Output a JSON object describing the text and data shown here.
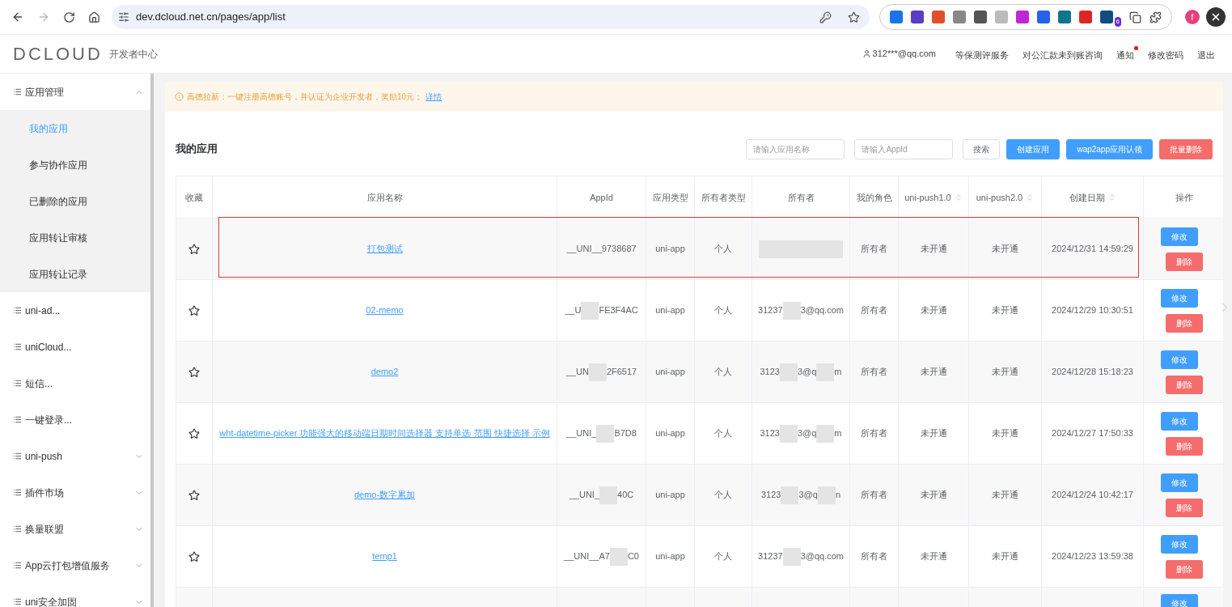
{
  "browser": {
    "url": "dev.dcloud.net.cn/pages/app/list",
    "extension_badge": "6",
    "profile": "f"
  },
  "header": {
    "logo": "DCLOUD",
    "subtitle": "开发者中心",
    "user": "312***@qq.com",
    "links": [
      {
        "label": "等保测评服务",
        "dot": false
      },
      {
        "label": "对公汇款未到账咨询",
        "dot": false
      },
      {
        "label": "通知",
        "dot": true
      },
      {
        "label": "修改密码",
        "dot": false
      },
      {
        "label": "退出",
        "dot": false
      }
    ]
  },
  "sidebar": {
    "items": [
      {
        "label": "应用管理",
        "expanded": true,
        "children": [
          {
            "label": "我的应用",
            "selected": true
          },
          {
            "label": "参与协作应用",
            "selected": false
          },
          {
            "label": "已删除的应用",
            "selected": false
          },
          {
            "label": "应用转让审核",
            "selected": false
          },
          {
            "label": "应用转让记录",
            "selected": false
          }
        ]
      },
      {
        "label": "uni-ad..."
      },
      {
        "label": "uniCloud..."
      },
      {
        "label": "短信..."
      },
      {
        "label": "一键登录..."
      },
      {
        "label": "uni-push",
        "expanded": false
      },
      {
        "label": "插件市场",
        "expanded": false
      },
      {
        "label": "换量联盟",
        "expanded": false
      },
      {
        "label": "App云打包增值服务",
        "expanded": false
      },
      {
        "label": "uni安全加固",
        "expanded": false
      }
    ]
  },
  "notice": {
    "text": "高德拉新：一键注册高德账号，并认证为企业开发者，奖励10元；",
    "link": "详情"
  },
  "page_title": "我的应用",
  "toolbar": {
    "name_placeholder": "请输入应用名称",
    "appid_placeholder": "请输入AppId",
    "buttons": [
      {
        "label": "搜索",
        "kind": "plain"
      },
      {
        "label": "创建应用",
        "kind": "primary"
      },
      {
        "label": "wap2app应用认领",
        "kind": "primary"
      },
      {
        "label": "批量删除",
        "kind": "danger"
      }
    ]
  },
  "table": {
    "columns": [
      {
        "label": "收藏",
        "sortable": false
      },
      {
        "label": "应用名称",
        "sortable": false
      },
      {
        "label": "AppId",
        "sortable": false
      },
      {
        "label": "应用类型",
        "sortable": false
      },
      {
        "label": "所有者类型",
        "sortable": false
      },
      {
        "label": "所有者",
        "sortable": false
      },
      {
        "label": "我的角色",
        "sortable": false
      },
      {
        "label": "uni-push1.0",
        "sortable": true
      },
      {
        "label": "uni-push2.0",
        "sortable": true
      },
      {
        "label": "创建日期",
        "sortable": true
      },
      {
        "label": "操作",
        "sortable": false
      }
    ],
    "rows": [
      {
        "highlighted": true,
        "name": "打包测试",
        "appid": [
          "__UNI__9738687"
        ],
        "type": "uni-app",
        "owner_type": "个人",
        "role": "所有者",
        "push1": "未开通",
        "push2": "未开通",
        "created": "2024/12/31 14:59:29",
        "actions": [
          "修改",
          "删除"
        ]
      },
      {
        "highlighted": false,
        "name": "02-memo",
        "appid": [
          "__U",
          "FE3F4AC"
        ],
        "type": "uni-app",
        "owner_type": "个人",
        "owner": [
          "31237",
          "3@qq.com"
        ],
        "role": "所有者",
        "push1": "未开通",
        "push2": "未开通",
        "created": "2024/12/29 10:30:51",
        "actions": [
          "修改",
          "删除"
        ]
      },
      {
        "highlighted": false,
        "name": "demo2",
        "appid": [
          "__UN",
          "2F6517"
        ],
        "type": "uni-app",
        "owner_type": "个人",
        "owner": [
          "3123",
          "3@q",
          "m"
        ],
        "role": "所有者",
        "push1": "未开通",
        "push2": "未开通",
        "created": "2024/12/28 15:18:23",
        "actions": [
          "修改",
          "删除"
        ]
      },
      {
        "highlighted": false,
        "name": "wht-datetime-picker 功能强大的移动端日期时间选择器 支持单选 范围 快捷选择 示例",
        "appid": [
          "__UNI_",
          "B7D8"
        ],
        "type": "uni-app",
        "owner_type": "个人",
        "owner": [
          "3123",
          "3@q",
          "m"
        ],
        "role": "所有者",
        "push1": "未开通",
        "push2": "未开通",
        "created": "2024/12/27 17:50:33",
        "actions": [
          "修改",
          "删除"
        ]
      },
      {
        "highlighted": false,
        "name": "demo-数字累加",
        "appid": [
          "__UNI_",
          "40C"
        ],
        "type": "uni-app",
        "owner_type": "个人",
        "owner": [
          "3123",
          "3@q",
          "n"
        ],
        "role": "所有者",
        "push1": "未开通",
        "push2": "未开通",
        "created": "2024/12/24 10:42:17",
        "actions": [
          "修改",
          "删除"
        ]
      },
      {
        "highlighted": false,
        "name": "temp1",
        "appid": [
          "__UNI__A7",
          "C0"
        ],
        "type": "uni-app",
        "owner_type": "个人",
        "owner": [
          "31237",
          "3@qq.com"
        ],
        "role": "所有者",
        "push1": "未开通",
        "push2": "未开通",
        "created": "2024/12/23 13:59:38",
        "actions": [
          "修改",
          "删除"
        ]
      },
      {
        "highlighted": false,
        "actions": [
          "修改"
        ]
      }
    ]
  }
}
